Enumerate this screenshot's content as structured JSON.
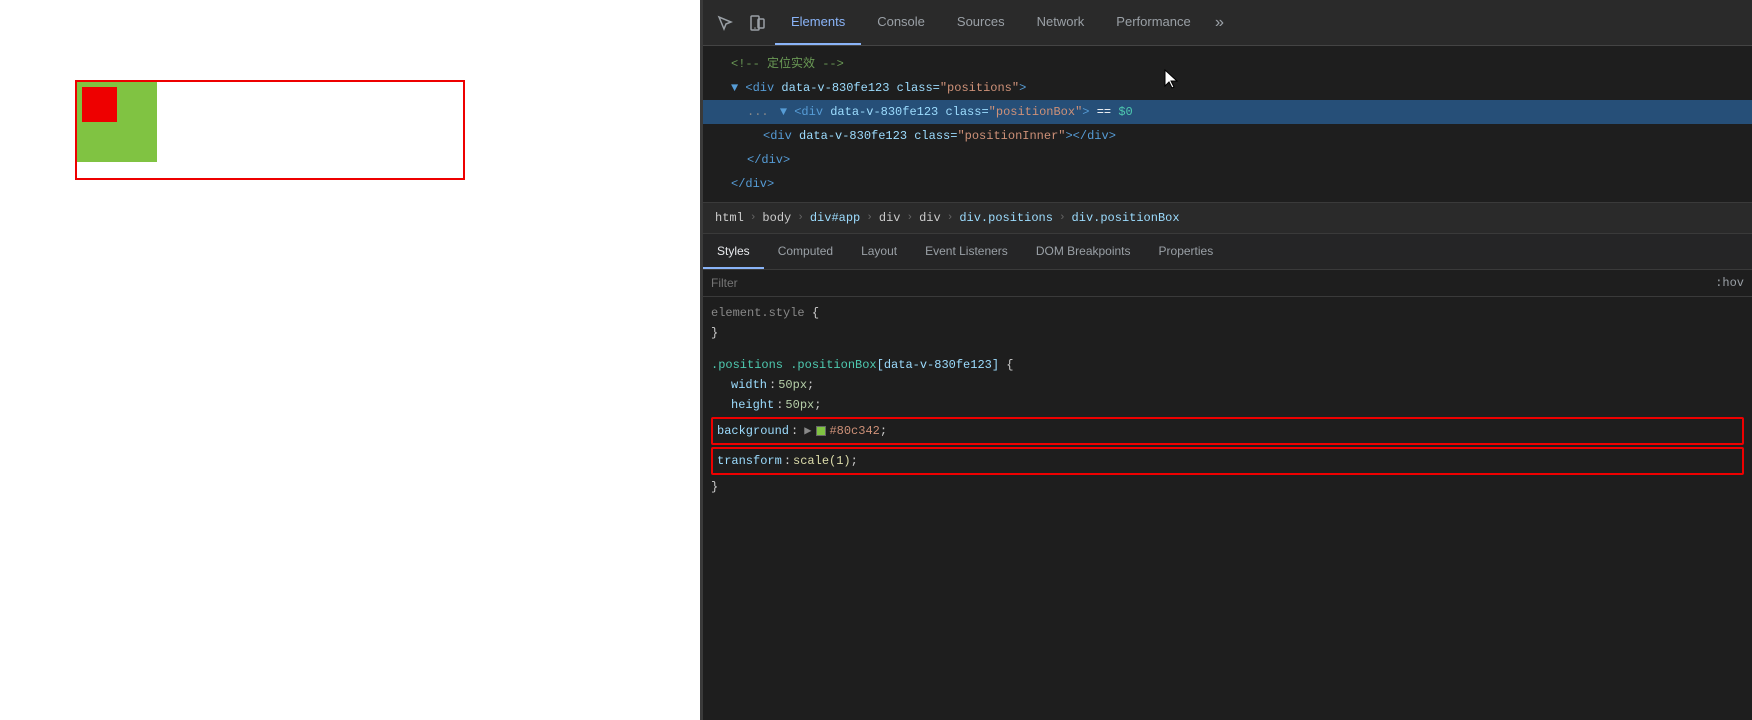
{
  "browser": {
    "demo_box": {
      "label": "demo-positioning-box"
    }
  },
  "devtools": {
    "toolbar": {
      "inspect_icon": "⬚",
      "device_icon": "📱",
      "overflow_label": "»"
    },
    "tabs": [
      {
        "id": "elements",
        "label": "Elements",
        "active": true
      },
      {
        "id": "console",
        "label": "Console",
        "active": false
      },
      {
        "id": "sources",
        "label": "Sources",
        "active": false
      },
      {
        "id": "network",
        "label": "Network",
        "active": false
      },
      {
        "id": "performance",
        "label": "Performance",
        "active": false
      }
    ],
    "html_tree": {
      "comment": "<!-- 定位实效 -->",
      "lines": [
        {
          "indent": 1,
          "content": "▼ <div data-v-830fe123 class=\"positions\">",
          "highlight": false
        },
        {
          "indent": 2,
          "content": "▼ <div data-v-830fe123 class=\"positionBox\"> == $0",
          "highlight": true
        },
        {
          "indent": 3,
          "content": "<div data-v-830fe123 class=\"positionInner\"></div>",
          "highlight": false
        },
        {
          "indent": 2,
          "content": "</div>",
          "highlight": false
        },
        {
          "indent": 1,
          "content": "</div>",
          "highlight": false
        }
      ]
    },
    "breadcrumb": {
      "items": [
        {
          "label": "html",
          "type": "plain"
        },
        {
          "label": "body",
          "type": "plain"
        },
        {
          "label": "div#app",
          "type": "link"
        },
        {
          "label": "div",
          "type": "plain"
        },
        {
          "label": "div",
          "type": "plain"
        },
        {
          "label": "div.positions",
          "type": "link"
        },
        {
          "label": "div.positionBox",
          "type": "link"
        }
      ]
    },
    "styles_tabs": [
      {
        "label": "Styles",
        "active": true
      },
      {
        "label": "Computed",
        "active": false
      },
      {
        "label": "Layout",
        "active": false
      },
      {
        "label": "Event Listeners",
        "active": false
      },
      {
        "label": "DOM Breakpoints",
        "active": false
      },
      {
        "label": "Properties",
        "active": false
      }
    ],
    "filter": {
      "placeholder": "Filter",
      "hov_label": ":hov"
    },
    "css_rules": [
      {
        "id": "element-style",
        "selector": "element.style {",
        "properties": [],
        "closing": "}"
      },
      {
        "id": "positions-positionbox",
        "selector": ".positions .positionBox[data-v-830fe123] {",
        "properties": [
          {
            "name": "width",
            "value": "50px",
            "type": "normal"
          },
          {
            "name": "height",
            "value": "50px",
            "type": "normal"
          },
          {
            "name": "background",
            "value": "#80c342",
            "type": "color",
            "color": "#80c342",
            "highlighted": true
          },
          {
            "name": "transform",
            "value": "scale(1)",
            "type": "normal",
            "highlighted": true
          }
        ],
        "closing": "}"
      }
    ]
  }
}
